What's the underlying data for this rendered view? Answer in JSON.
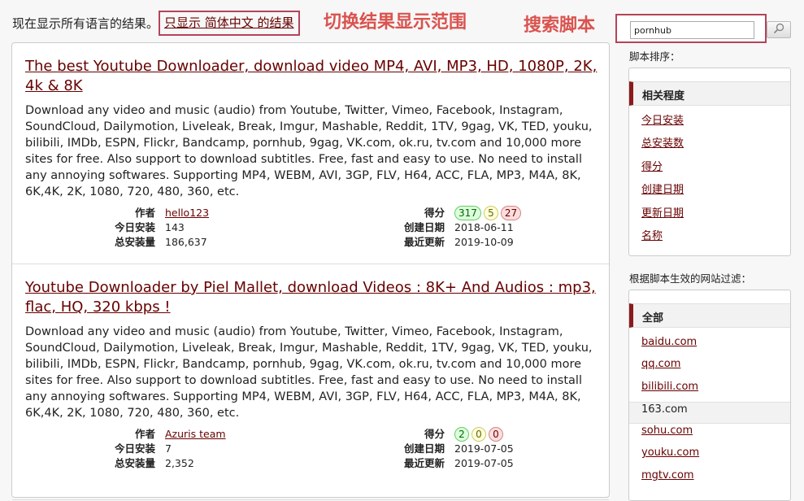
{
  "notice": {
    "text": "现在显示所有语言的结果。",
    "link": "只显示 简体中文 的结果"
  },
  "annotations": {
    "switch": "切换结果显示范围",
    "search": "搜索脚本"
  },
  "search": {
    "value": "pornhub"
  },
  "results": [
    {
      "title": "The best Youtube Downloader, download video MP4, AVI, MP3, HD, 1080P, 2K, 4k & 8K",
      "description": "Download any video and music (audio) from Youtube, Twitter, Vimeo, Facebook, Instagram, SoundCloud, Dailymotion, Liveleak, Break, Imgur, Mashable, Reddit, 1TV, 9gag, VK, TED, youku, bilibili, IMDb, ESPN, Flickr, Bandcamp, pornhub, 9gag, VK.com, ok.ru, tv.com and 10,000 more sites for free. Also support to download subtitles. Free, fast and easy to use. No need to install any annoying softwares. Supporting MP4, WEBM, AVI, 3GP, FLV, H64, ACC, FLA, MP3, M4A, 8K, 6K,4K, 2K, 1080, 720, 480, 360, etc.",
      "author_label": "作者",
      "author": "hello123",
      "daily_label": "今日安装",
      "daily": "143",
      "total_label": "总安装量",
      "total": "186,637",
      "score_label": "得分",
      "score_good": "317",
      "score_ok": "5",
      "score_bad": "27",
      "created_label": "创建日期",
      "created": "2018-06-11",
      "updated_label": "最近更新",
      "updated": "2019-10-09"
    },
    {
      "title": "Youtube Downloader by Piel Mallet, download Videos : 8K+ And Audios : mp3, flac, HQ, 320 kbps !",
      "description": "Download any video and music (audio) from Youtube, Twitter, Vimeo, Facebook, Instagram, SoundCloud, Dailymotion, Liveleak, Break, Imgur, Mashable, Reddit, 1TV, 9gag, VK, TED, youku, bilibili, IMDb, ESPN, Flickr, Bandcamp, pornhub, 9gag, VK.com, ok.ru, tv.com and 10,000 more sites for free. Also support to download subtitles. Free, fast and easy to use. No need to install any annoying softwares. Supporting MP4, WEBM, AVI, 3GP, FLV, H64, ACC, FLA, MP3, M4A, 8K, 6K,4K, 2K, 1080, 720, 480, 360, etc.",
      "author_label": "作者",
      "author": "Azuris team",
      "daily_label": "今日安装",
      "daily": "7",
      "total_label": "总安装量",
      "total": "2,352",
      "score_label": "得分",
      "score_good": "2",
      "score_ok": "0",
      "score_bad": "0",
      "created_label": "创建日期",
      "created": "2019-07-05",
      "updated_label": "最近更新",
      "updated": "2019-07-05"
    }
  ],
  "sidebar": {
    "sort_label": "脚本排序：",
    "sort_active": "相关程度",
    "sort_options": [
      "今日安装",
      "总安装数",
      "得分",
      "创建日期",
      "更新日期",
      "名称"
    ],
    "filter_label": "根据脚本生效的网站过滤：",
    "filter_active": "全部",
    "sites": [
      "baidu.com",
      "qq.com",
      "bilibili.com",
      "163.com",
      "sohu.com",
      "youku.com",
      "mgtv.com"
    ]
  },
  "colors": {
    "link": "#670000",
    "annotation": "#d9534f",
    "accent_bar": "#8b1a1a"
  }
}
